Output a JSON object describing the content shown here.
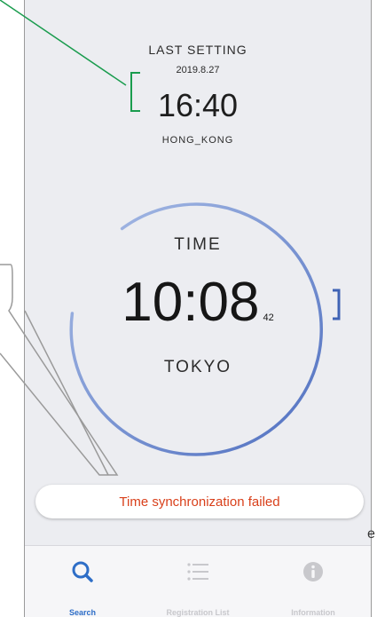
{
  "last_setting": {
    "title": "LAST SETTING",
    "date": "2019.8.27",
    "time": "16:40",
    "timezone": "HONG_KONG"
  },
  "clock": {
    "label": "TIME",
    "time": "10:08",
    "seconds": "42",
    "timezone": "TOKYO"
  },
  "toast": {
    "message": "Time synchronization failed"
  },
  "tabs": [
    {
      "label": "Search",
      "icon": "search-icon",
      "active": true
    },
    {
      "label": "Registration List",
      "icon": "list-icon",
      "active": false
    },
    {
      "label": "Information",
      "icon": "info-icon",
      "active": false
    }
  ],
  "annotation": {
    "fragment": "e"
  },
  "colors": {
    "accent": "#2e6ec7",
    "error": "#d9401b",
    "callout_line": "#1a9c4e",
    "dial": "#6f8ccf"
  }
}
